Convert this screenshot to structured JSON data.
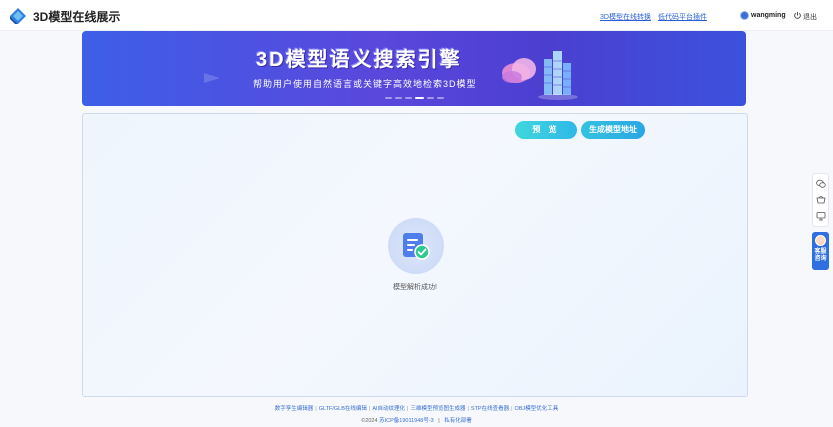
{
  "header": {
    "title": "3D模型在线展示",
    "links": [
      "3D模型在线转换",
      "低代码平台插件"
    ],
    "username": "wangming",
    "logout": "退出"
  },
  "banner": {
    "title": "3D模型语义搜索引擎",
    "subtitle": "帮助用户使用自然语言或关键字高效地检索3D模型",
    "dots_count": 6,
    "active_dot": 3
  },
  "panel": {
    "preview_label": "预 览",
    "address_label": "生成模型地址",
    "status_text": "模型解析成功!"
  },
  "service": {
    "label_line1": "客服",
    "label_line2": "咨询"
  },
  "footer": {
    "links": [
      "数字孪生编辑器",
      "GLTF/GLB在线编辑",
      "AI自动纹理化",
      "三维模型预览图生成器",
      "STP在线查看器",
      "OBJ模型优化工具"
    ],
    "copyright": "©2024",
    "icp": "苏ICP备19011948号-3",
    "divider": "|",
    "private": "私有化部署"
  },
  "colors": {
    "accent": "#2f6fe0",
    "button_cyan": "#3fd7dc",
    "banner": "#4b48dc"
  }
}
